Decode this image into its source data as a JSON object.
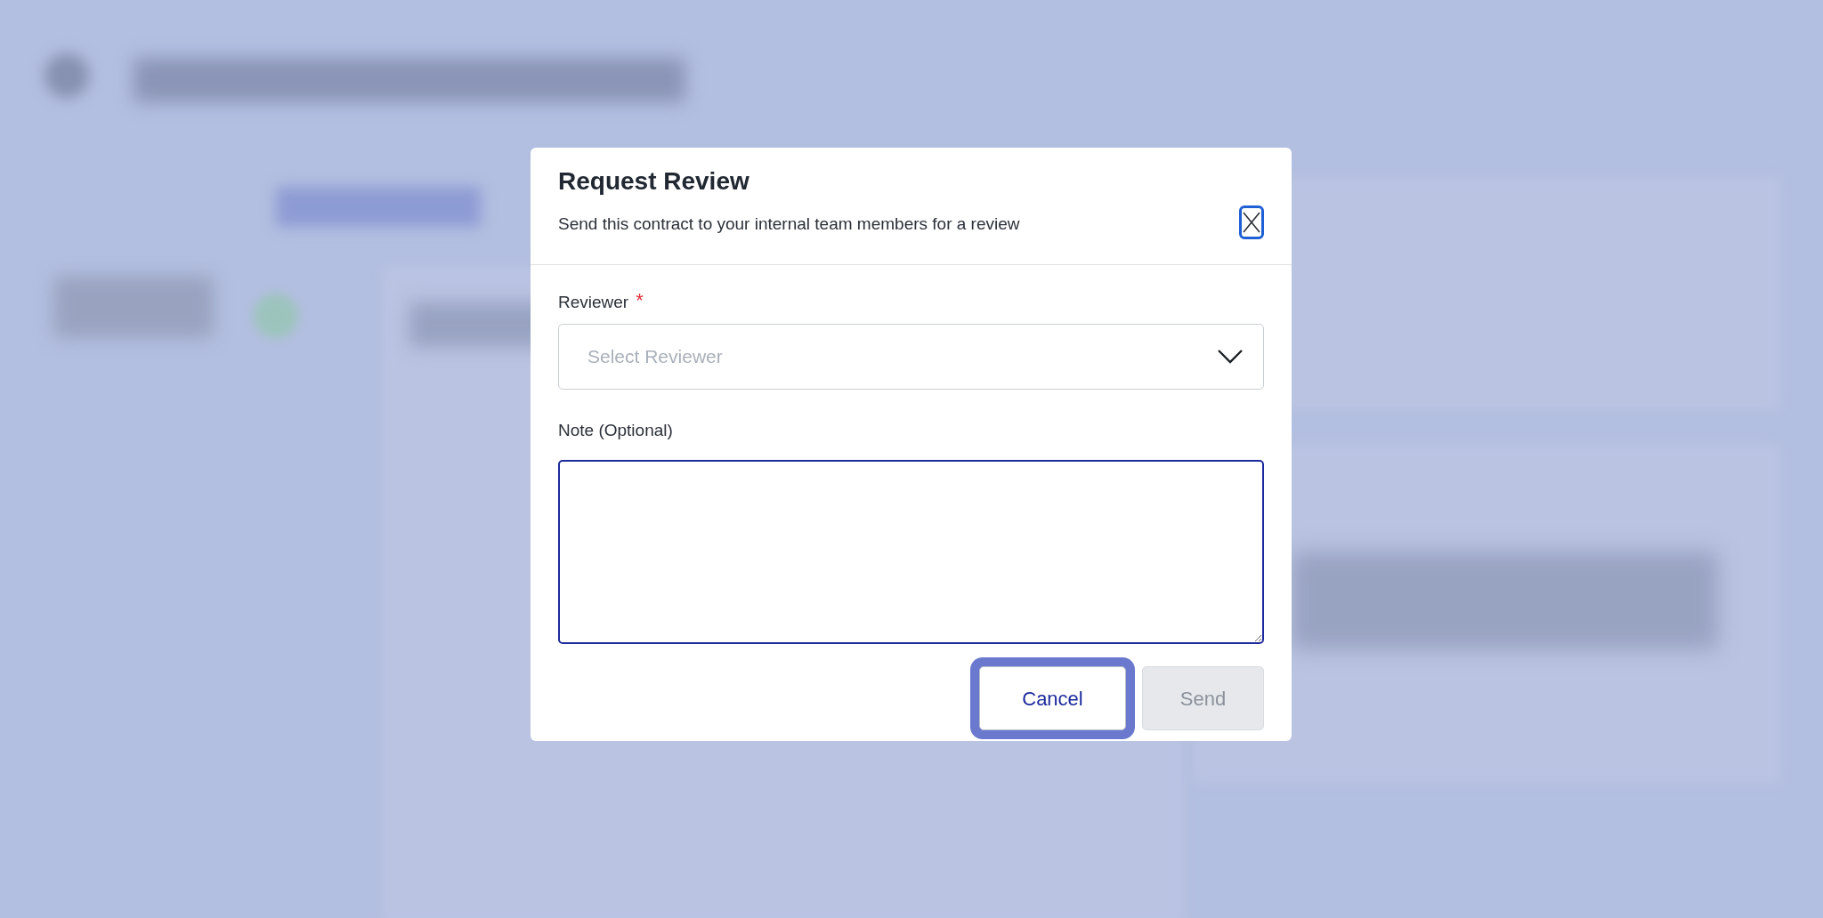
{
  "dialog": {
    "title": "Request Review",
    "subtitle": "Send this contract to your internal team members for a review"
  },
  "fields": [
    {
      "kind": "select",
      "label": "Reviewer",
      "required_mark": "*",
      "placeholder": "Select Reviewer"
    },
    {
      "kind": "textarea",
      "label": "Note (Optional)"
    }
  ],
  "buttons": [
    {
      "label": "Cancel",
      "focused": true,
      "disabled": false
    },
    {
      "label": "Send",
      "focused": false,
      "disabled": true
    }
  ]
}
